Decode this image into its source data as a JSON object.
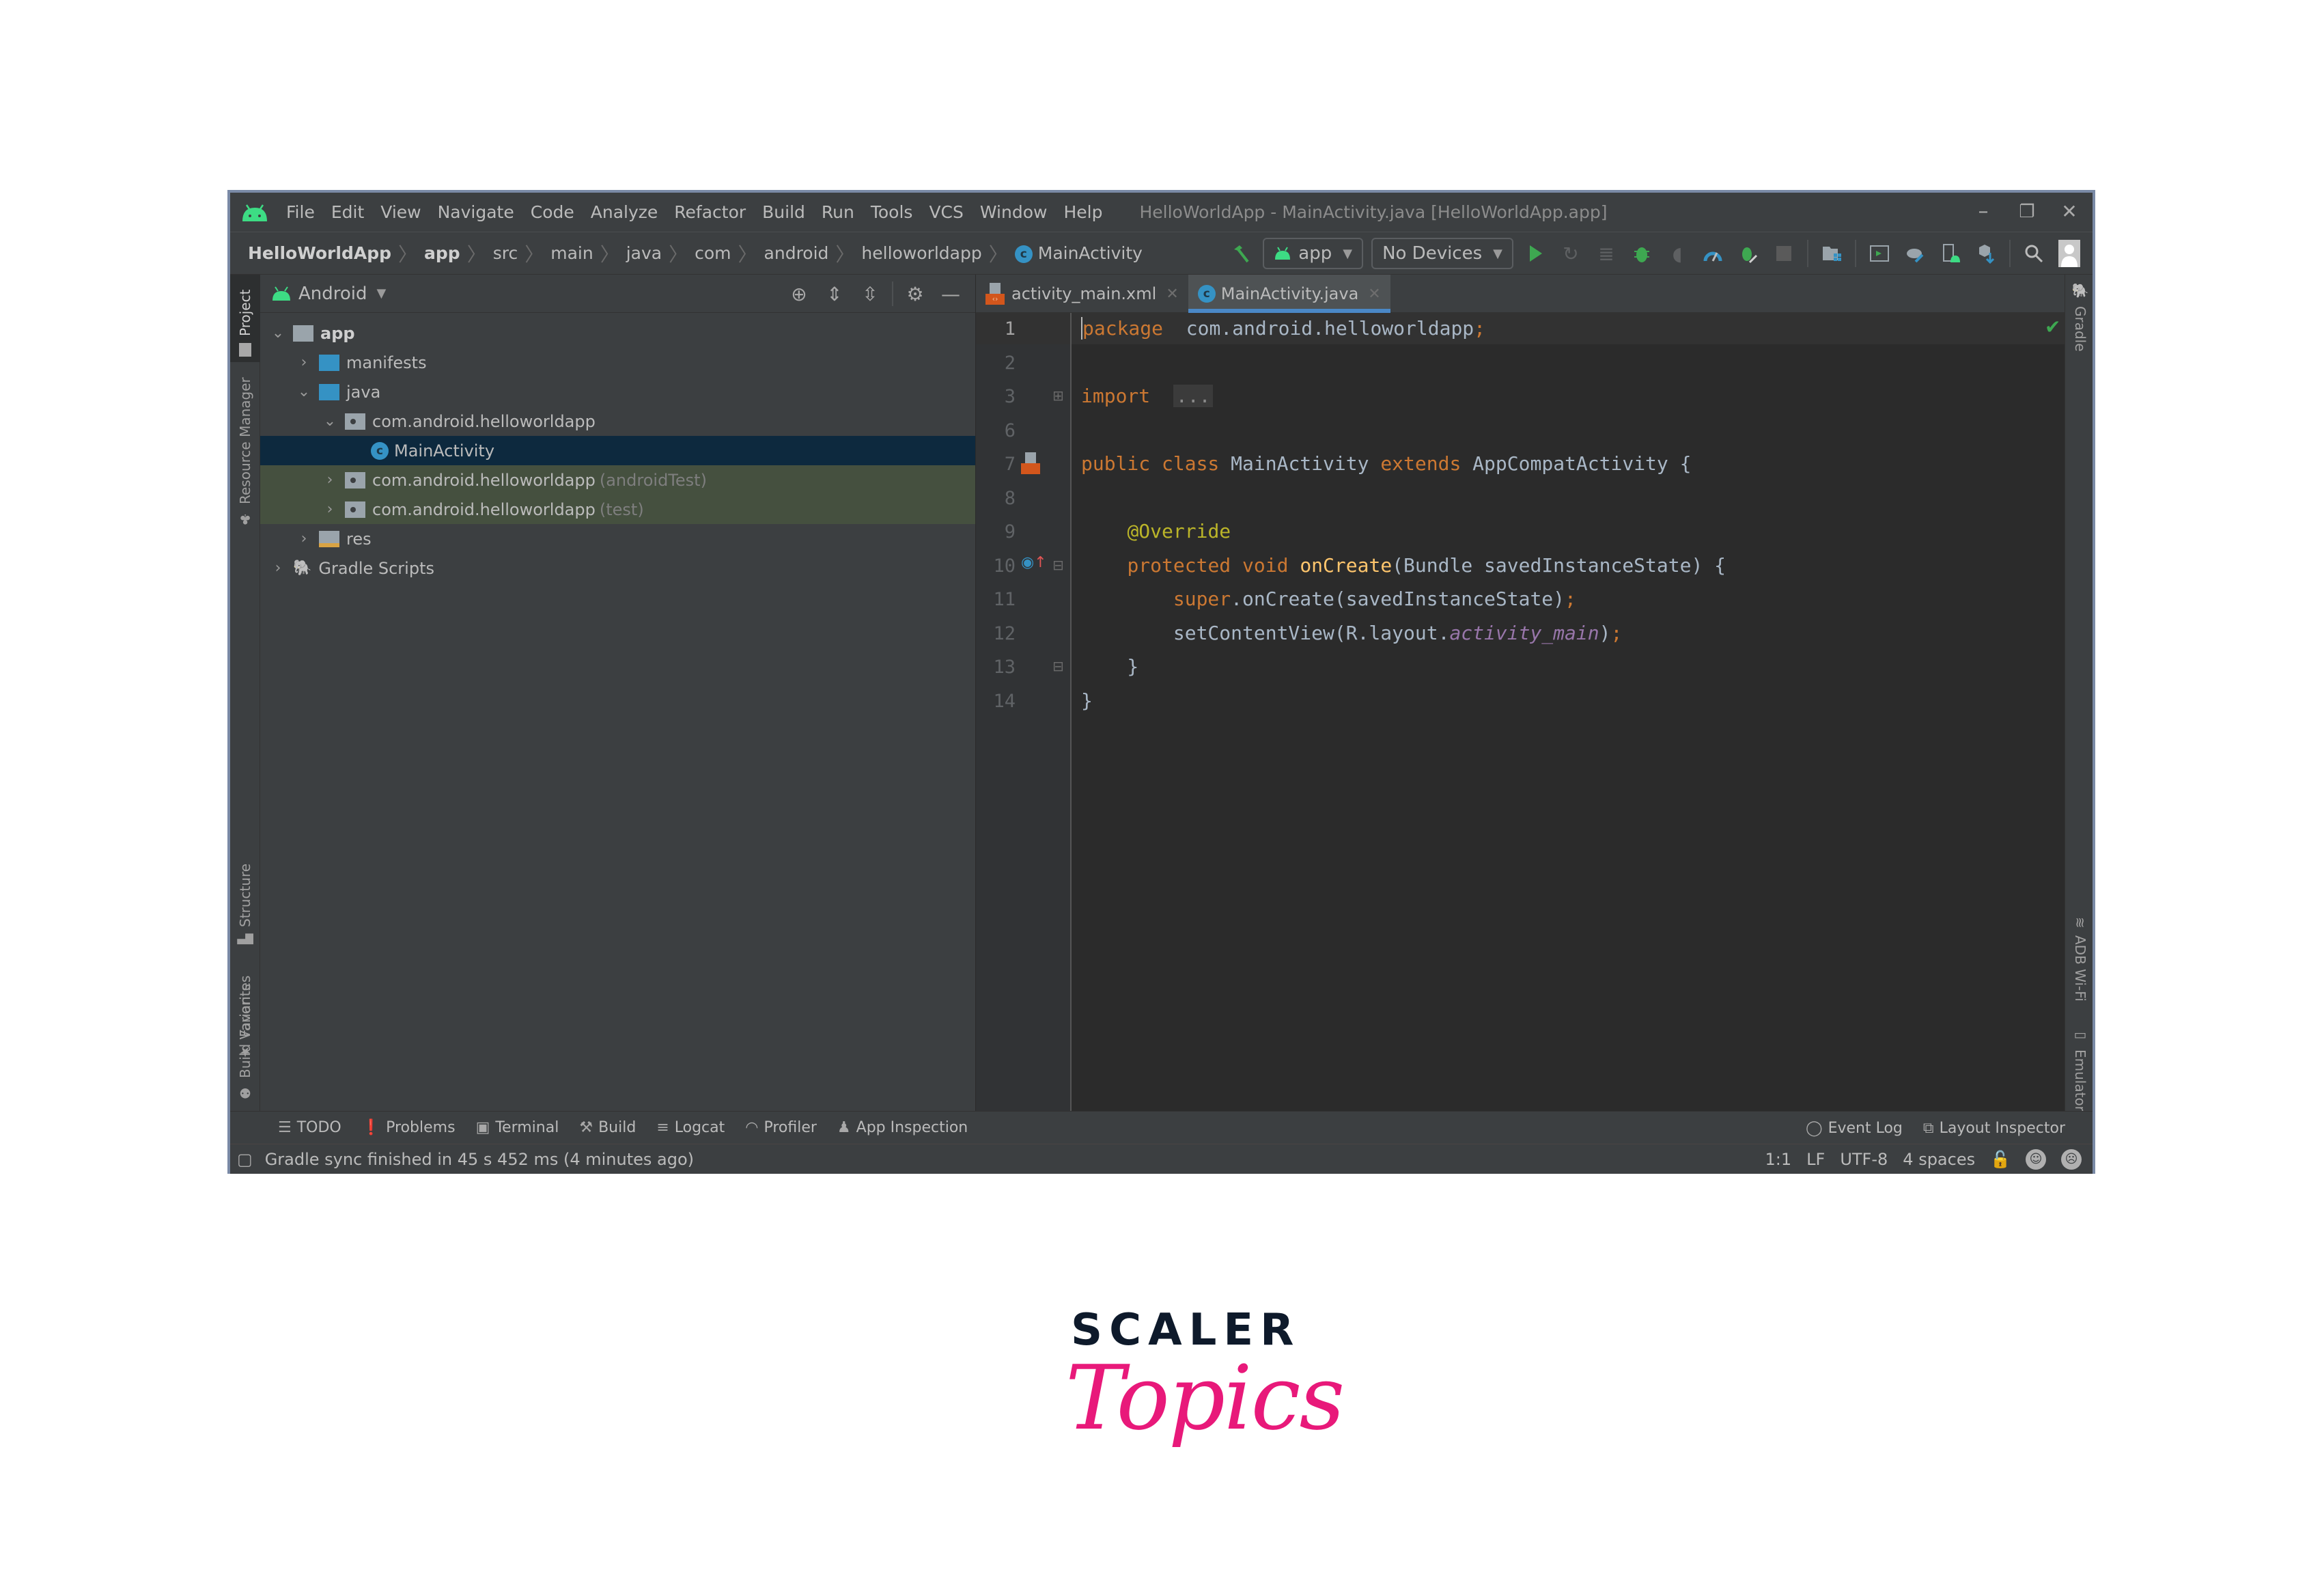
{
  "window": {
    "title": "HelloWorldApp - MainActivity.java [HelloWorldApp.app]",
    "menu": [
      "File",
      "Edit",
      "View",
      "Navigate",
      "Code",
      "Analyze",
      "Refactor",
      "Build",
      "Run",
      "Tools",
      "VCS",
      "Window",
      "Help"
    ],
    "controls": {
      "minimize": "–",
      "restore": "❐",
      "close": "✕"
    }
  },
  "breadcrumb": [
    "HelloWorldApp",
    "app",
    "src",
    "main",
    "java",
    "com",
    "android",
    "helloworldapp",
    "MainActivity"
  ],
  "toolbar": {
    "run_config": "app",
    "device": "No Devices",
    "icons": [
      "hammer-icon",
      "run-icon",
      "apply-changes-icon",
      "apply-code-changes-icon",
      "debug-icon",
      "attach-debugger-icon",
      "profile-icon",
      "attach-profiler-icon",
      "stop-icon",
      "project-structure-icon",
      "avd-manager-icon",
      "sync-gradle-icon",
      "device-manager-icon",
      "sdk-manager-icon",
      "search-icon",
      "account-icon"
    ]
  },
  "left_strip": [
    "Project",
    "Resource Manager",
    "Structure",
    "Favorites",
    "Build Variants"
  ],
  "right_strip": [
    "Gradle",
    "ADB Wi-Fi",
    "Emulator"
  ],
  "project_panel": {
    "view": "Android",
    "tree": [
      {
        "label": "app",
        "depth": 0,
        "expanded": true,
        "bold": true,
        "type": "module"
      },
      {
        "label": "manifests",
        "depth": 1,
        "expanded": false,
        "type": "folder-blue"
      },
      {
        "label": "java",
        "depth": 1,
        "expanded": true,
        "type": "folder-blue"
      },
      {
        "label": "com.android.helloworldapp",
        "depth": 2,
        "expanded": true,
        "type": "package"
      },
      {
        "label": "MainActivity",
        "depth": 3,
        "type": "class",
        "selected": true
      },
      {
        "label": "com.android.helloworldapp",
        "suffix": "(androidTest)",
        "depth": 2,
        "expanded": false,
        "type": "package",
        "test": true
      },
      {
        "label": "com.android.helloworldapp",
        "suffix": "(test)",
        "depth": 2,
        "expanded": false,
        "type": "package",
        "test": true
      },
      {
        "label": "res",
        "depth": 1,
        "expanded": false,
        "type": "folder-res"
      },
      {
        "label": "Gradle Scripts",
        "depth": 0,
        "expanded": false,
        "type": "gradle"
      }
    ]
  },
  "editor": {
    "tabs": [
      {
        "label": "activity_main.xml",
        "active": false
      },
      {
        "label": "MainActivity.java",
        "active": true
      }
    ],
    "lines": [
      {
        "no": "1",
        "tokens": [
          [
            "kw",
            "package"
          ],
          [
            "",
            "  com.android.helloworldapp"
          ],
          [
            "kw",
            ";"
          ]
        ]
      },
      {
        "no": "2",
        "tokens": []
      },
      {
        "no": "3",
        "tokens": [
          [
            "kw",
            "import"
          ],
          [
            "",
            "  "
          ],
          [
            "fold",
            "..."
          ]
        ]
      },
      {
        "no": "6",
        "tokens": []
      },
      {
        "no": "7",
        "tokens": [
          [
            "kw",
            "public class"
          ],
          [
            "",
            " MainActivity "
          ],
          [
            "kw",
            "extends"
          ],
          [
            "",
            " AppCompatActivity {"
          ]
        ]
      },
      {
        "no": "8",
        "tokens": []
      },
      {
        "no": "9",
        "tokens": [
          [
            "",
            "    "
          ],
          [
            "ann",
            "@Override"
          ]
        ]
      },
      {
        "no": "10",
        "tokens": [
          [
            "",
            "    "
          ],
          [
            "kw",
            "protected void"
          ],
          [
            "",
            " "
          ],
          [
            "fn",
            "onCreate"
          ],
          [
            "",
            "(Bundle savedInstanceState) {"
          ]
        ]
      },
      {
        "no": "11",
        "tokens": [
          [
            "",
            "        "
          ],
          [
            "kw",
            "super"
          ],
          [
            "",
            ".onCreate(savedInstanceState)"
          ],
          [
            "kw",
            ";"
          ]
        ]
      },
      {
        "no": "12",
        "tokens": [
          [
            "",
            "        setContentView(R.layout."
          ],
          [
            "field",
            "activity_main"
          ],
          [
            "",
            ")"
          ],
          [
            "kw",
            ";"
          ]
        ]
      },
      {
        "no": "13",
        "tokens": [
          [
            "",
            "    }"
          ]
        ]
      },
      {
        "no": "14",
        "tokens": [
          [
            "",
            "}"
          ]
        ]
      }
    ],
    "inspection_status": "ok"
  },
  "tool_windows": {
    "left": [
      "TODO",
      "Problems",
      "Terminal",
      "Build",
      "Logcat",
      "Profiler",
      "App Inspection"
    ],
    "right": [
      "Event Log",
      "Layout Inspector"
    ]
  },
  "status_bar": {
    "message": "Gradle sync finished in 45 s 452 ms (4 minutes ago)",
    "position": "1:1",
    "line_separator": "LF",
    "encoding": "UTF-8",
    "indent": "4 spaces"
  },
  "brand": {
    "line1": "SCALER",
    "line2": "Topics",
    "colors": {
      "dark": "#0e1a2b",
      "pink": "#e8197a"
    }
  },
  "colors": {
    "android_green": "#3ddc84",
    "accent_blue": "#4a88c7",
    "keyword": "#cc7832",
    "annotation": "#bbb529",
    "function": "#ffc66d",
    "field": "#9876aa"
  }
}
